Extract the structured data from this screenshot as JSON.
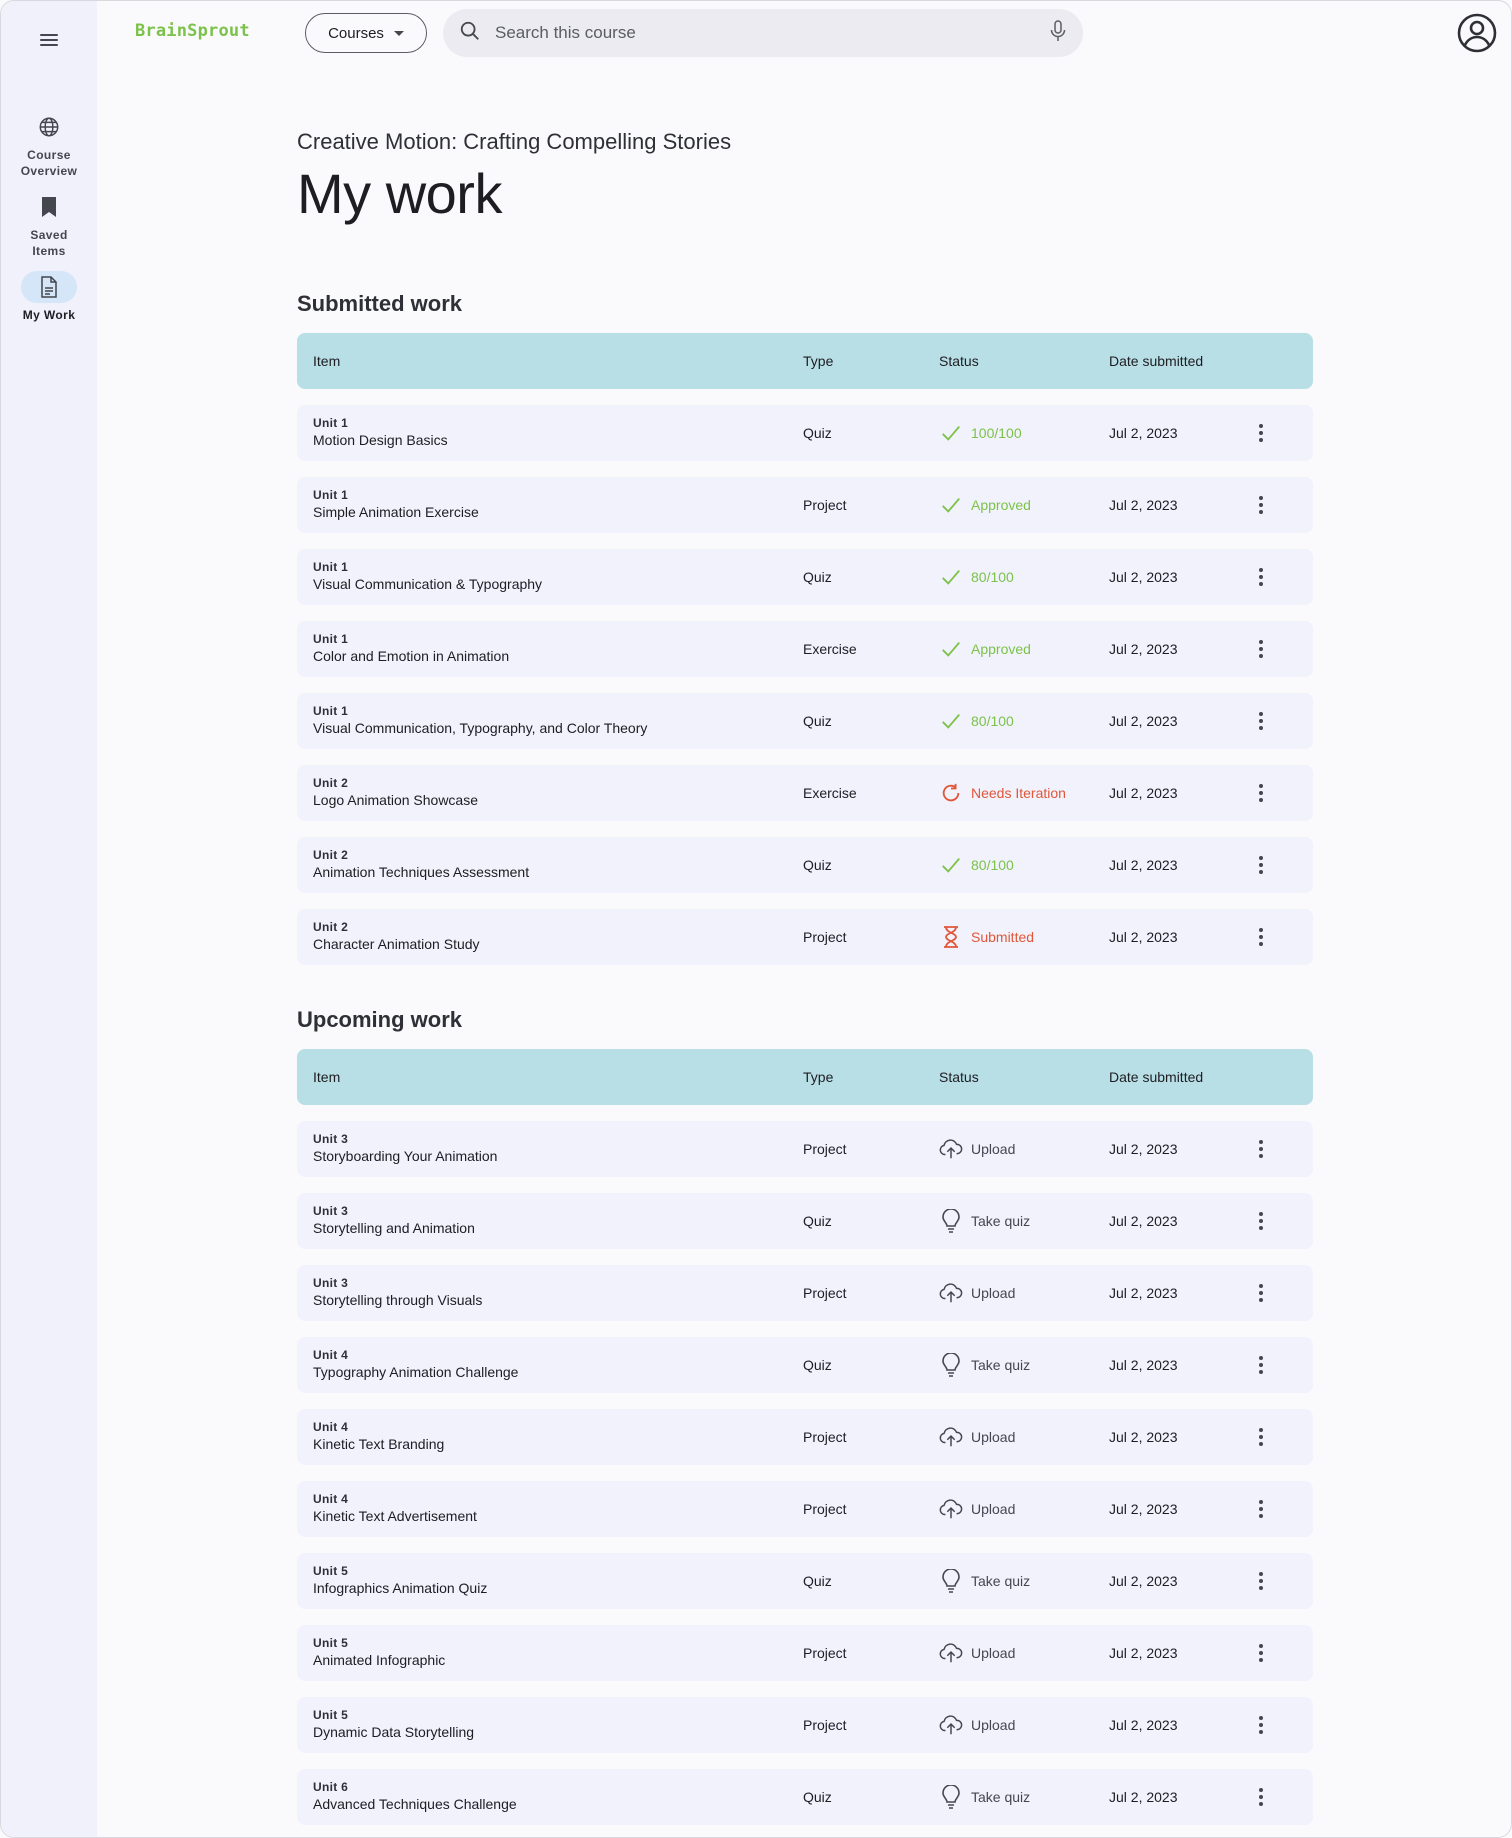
{
  "brand": {
    "name": "BrainSprout",
    "color": "#7cc24a"
  },
  "nav": {
    "items": [
      {
        "id": "overview",
        "label_line1": "Course",
        "label_line2": "Overview",
        "icon": "globe-icon",
        "active": false
      },
      {
        "id": "saved",
        "label_line1": "Saved",
        "label_line2": "Items",
        "icon": "bookmark-icon",
        "active": false
      },
      {
        "id": "mywork",
        "label_line1": "My Work",
        "label_line2": "",
        "icon": "document-icon",
        "active": true
      }
    ]
  },
  "topbar": {
    "courses_label": "Courses",
    "search_placeholder": "Search this course"
  },
  "page": {
    "course_title": "Creative Motion: Crafting Compelling  Stories",
    "title": "My work"
  },
  "columns": {
    "item": "Item",
    "type": "Type",
    "status": "Status",
    "date": "Date submitted"
  },
  "colors": {
    "header_bg": "#b8dfe6",
    "ok": "#7cc24a",
    "warn": "#e0573a"
  },
  "submitted": {
    "title": "Submitted work",
    "rows": [
      {
        "unit": "Unit 1",
        "name": "Motion Design Basics",
        "type": "Quiz",
        "status": "100/100",
        "status_kind": "check",
        "date": "Jul 2, 2023"
      },
      {
        "unit": "Unit 1",
        "name": "Simple Animation Exercise",
        "type": "Project",
        "status": "Approved",
        "status_kind": "check",
        "date": "Jul 2, 2023"
      },
      {
        "unit": "Unit 1",
        "name": "Visual Communication & Typography",
        "type": "Quiz",
        "status": "80/100",
        "status_kind": "check",
        "date": "Jul 2, 2023"
      },
      {
        "unit": "Unit 1",
        "name": "Color and Emotion in Animation",
        "type": "Exercise",
        "status": "Approved",
        "status_kind": "check",
        "date": "Jul 2, 2023"
      },
      {
        "unit": "Unit 1",
        "name": "Visual Communication, Typography, and Color Theory",
        "type": "Quiz",
        "status": "80/100",
        "status_kind": "check",
        "date": "Jul 2, 2023"
      },
      {
        "unit": "Unit 2",
        "name": "Logo Animation Showcase",
        "type": "Exercise",
        "status": "Needs Iteration",
        "status_kind": "refresh",
        "date": "Jul 2, 2023"
      },
      {
        "unit": "Unit 2",
        "name": "Animation Techniques Assessment",
        "type": "Quiz",
        "status": "80/100",
        "status_kind": "check",
        "date": "Jul 2, 2023"
      },
      {
        "unit": "Unit 2",
        "name": "Character Animation Study",
        "type": "Project",
        "status": "Submitted",
        "status_kind": "hourglass",
        "date": "Jul 2, 2023"
      }
    ]
  },
  "upcoming": {
    "title": "Upcoming work",
    "rows": [
      {
        "unit": "Unit 3",
        "name": "Storyboarding Your Animation",
        "type": "Project",
        "status": "Upload",
        "status_kind": "upload",
        "date": "Jul 2, 2023"
      },
      {
        "unit": "Unit 3",
        "name": "Storytelling and Animation",
        "type": "Quiz",
        "status": "Take quiz",
        "status_kind": "bulb",
        "date": "Jul 2, 2023"
      },
      {
        "unit": "Unit 3",
        "name": "Storytelling through Visuals",
        "type": "Project",
        "status": "Upload",
        "status_kind": "upload",
        "date": "Jul 2, 2023"
      },
      {
        "unit": "Unit 4",
        "name": "Typography Animation Challenge",
        "type": "Quiz",
        "status": "Take quiz",
        "status_kind": "bulb",
        "date": "Jul 2, 2023"
      },
      {
        "unit": "Unit 4",
        "name": "Kinetic Text Branding",
        "type": "Project",
        "status": "Upload",
        "status_kind": "upload",
        "date": "Jul 2, 2023"
      },
      {
        "unit": "Unit 4",
        "name": "Kinetic Text Advertisement",
        "type": "Project",
        "status": "Upload",
        "status_kind": "upload",
        "date": "Jul 2, 2023"
      },
      {
        "unit": "Unit 5",
        "name": "Infographics Animation Quiz",
        "type": "Quiz",
        "status": "Take quiz",
        "status_kind": "bulb",
        "date": "Jul 2, 2023"
      },
      {
        "unit": "Unit 5",
        "name": "Animated Infographic",
        "type": "Project",
        "status": "Upload",
        "status_kind": "upload",
        "date": "Jul 2, 2023"
      },
      {
        "unit": "Unit 5",
        "name": "Dynamic Data Storytelling",
        "type": "Project",
        "status": "Upload",
        "status_kind": "upload",
        "date": "Jul 2, 2023"
      },
      {
        "unit": "Unit 6",
        "name": "Advanced Techniques Challenge",
        "type": "Quiz",
        "status": "Take quiz",
        "status_kind": "bulb",
        "date": "Jul 2, 2023"
      }
    ]
  }
}
